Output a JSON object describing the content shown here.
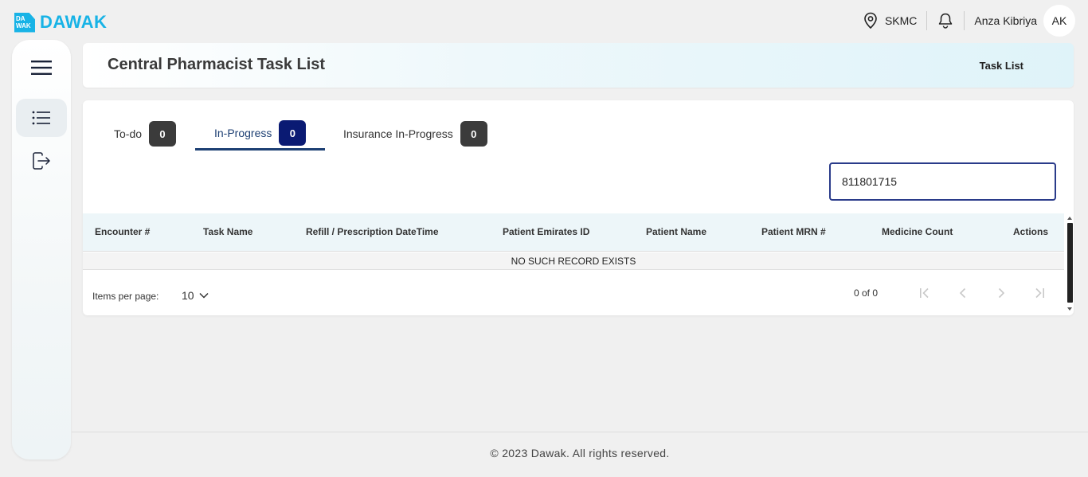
{
  "brand": {
    "mark_text": "DA WAK",
    "name": "DAWAK",
    "color": "#18b3e6"
  },
  "topbar": {
    "location": "SKMC",
    "user_name": "Anza Kibriya",
    "avatar_initials": "AK"
  },
  "sidebar": {
    "items": [
      {
        "icon": "hamburger-menu-icon"
      },
      {
        "icon": "list-icon",
        "active": true
      },
      {
        "icon": "logout-icon"
      }
    ]
  },
  "header": {
    "title": "Central Pharmacist Task List",
    "breadcrumb": "Task List"
  },
  "tabs": [
    {
      "label": "To-do",
      "count": "0",
      "active": false
    },
    {
      "label": "In-Progress",
      "count": "0",
      "active": true
    },
    {
      "label": "Insurance In-Progress",
      "count": "0",
      "active": false
    }
  ],
  "search": {
    "value": "811801715"
  },
  "table": {
    "columns": [
      "Encounter #",
      "Task Name",
      "Refill / Prescription DateTime",
      "Patient Emirates ID",
      "Patient Name",
      "Patient MRN #",
      "Medicine Count",
      "Actions"
    ],
    "empty_message": "NO SUCH RECORD EXISTS"
  },
  "paginator": {
    "items_per_page_label": "Items per page:",
    "items_per_page": "10",
    "range": "0 of 0"
  },
  "footer": {
    "text": "© 2023 Dawak. All rights reserved."
  },
  "colors": {
    "accent": "#1d3f73",
    "active_badge": "#0a1a73",
    "badge": "#3b3b3b",
    "search_border": "#2a3b8a"
  }
}
